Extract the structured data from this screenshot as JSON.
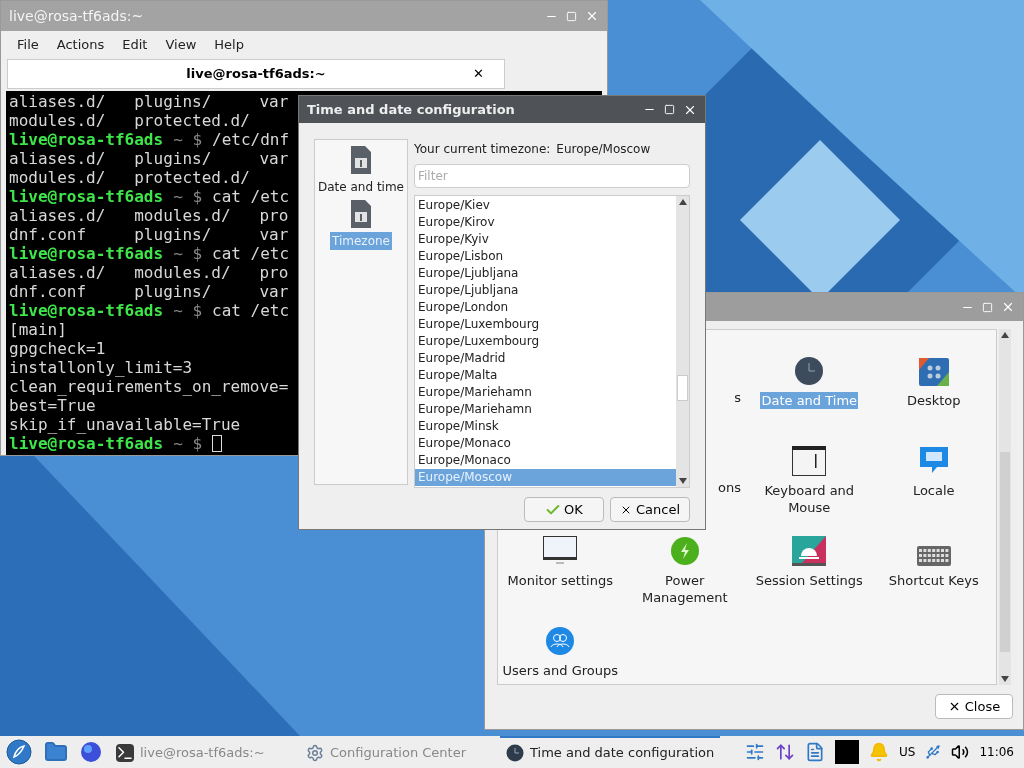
{
  "terminal": {
    "title": "live@rosa-tf6ads:~",
    "menu": [
      "File",
      "Actions",
      "Edit",
      "View",
      "Help"
    ],
    "tab": {
      "label": "live@rosa-tf6ads:~",
      "close": "✕"
    },
    "lines": [
      {
        "kind": "output",
        "text": "aliases.d/   plugins/     var"
      },
      {
        "kind": "output",
        "text": "modules.d/   protected.d/"
      },
      {
        "kind": "prompt",
        "user": "live@rosa-tf6ads",
        "symbol": "~ $",
        "command": "/etc/dnf"
      },
      {
        "kind": "output",
        "text": "aliases.d/   plugins/     var"
      },
      {
        "kind": "output",
        "text": "modules.d/   protected.d/"
      },
      {
        "kind": "prompt",
        "user": "live@rosa-tf6ads",
        "symbol": "~ $",
        "command": "cat /etc"
      },
      {
        "kind": "output",
        "text": "aliases.d/   modules.d/   pro"
      },
      {
        "kind": "output",
        "text": "dnf.conf     plugins/     var"
      },
      {
        "kind": "prompt",
        "user": "live@rosa-tf6ads",
        "symbol": "~ $",
        "command": "cat /etc"
      },
      {
        "kind": "output",
        "text": "aliases.d/   modules.d/   pro"
      },
      {
        "kind": "output",
        "text": "dnf.conf     plugins/     var"
      },
      {
        "kind": "prompt",
        "user": "live@rosa-tf6ads",
        "symbol": "~ $",
        "command": "cat /etc"
      },
      {
        "kind": "output",
        "text": "[main]"
      },
      {
        "kind": "output",
        "text": "gpgcheck=1"
      },
      {
        "kind": "output",
        "text": "installonly_limit=3"
      },
      {
        "kind": "output",
        "text": "clean_requirements_on_remove="
      },
      {
        "kind": "output",
        "text": "best=True"
      },
      {
        "kind": "output",
        "text": "skip_if_unavailable=True"
      },
      {
        "kind": "cursor",
        "user": "live@rosa-tf6ads",
        "symbol": "~ $"
      }
    ]
  },
  "dialog": {
    "title": "Time and date configuration",
    "sidebar": [
      {
        "label": "Date and time",
        "selected": false
      },
      {
        "label": "Timezone",
        "selected": true
      }
    ],
    "current_label": "Your current timezone:",
    "current_value": "Europe/Moscow",
    "filter": {
      "placeholder": "Filter"
    },
    "timezones": [
      {
        "label": "Europe/Kiev",
        "selected": false
      },
      {
        "label": "Europe/Kirov",
        "selected": false
      },
      {
        "label": "Europe/Kyiv",
        "selected": false
      },
      {
        "label": "Europe/Lisbon",
        "selected": false
      },
      {
        "label": "Europe/Ljubljana",
        "selected": false
      },
      {
        "label": "Europe/Ljubljana",
        "selected": false
      },
      {
        "label": "Europe/London",
        "selected": false
      },
      {
        "label": "Europe/Luxembourg",
        "selected": false
      },
      {
        "label": "Europe/Luxembourg",
        "selected": false
      },
      {
        "label": "Europe/Madrid",
        "selected": false
      },
      {
        "label": "Europe/Malta",
        "selected": false
      },
      {
        "label": "Europe/Mariehamn",
        "selected": false
      },
      {
        "label": "Europe/Mariehamn",
        "selected": false
      },
      {
        "label": "Europe/Minsk",
        "selected": false
      },
      {
        "label": "Europe/Monaco",
        "selected": false
      },
      {
        "label": "Europe/Monaco",
        "selected": false
      },
      {
        "label": "Europe/Moscow",
        "selected": true
      }
    ],
    "buttons": {
      "ok": "OK",
      "cancel": "Cancel"
    }
  },
  "config": {
    "items": [
      {
        "kind": "partial",
        "label": "s"
      },
      {
        "kind": "clock",
        "label": "Date and Time",
        "selected": true
      },
      {
        "kind": "desktop",
        "label": "Desktop",
        "selected": false
      },
      {
        "kind": "partial",
        "label": "ons"
      },
      {
        "kind": "keyboard-mouse",
        "label": "Keyboard and Mouse",
        "selected": false
      },
      {
        "kind": "locale",
        "label": "Locale",
        "selected": false
      },
      {
        "kind": "monitor",
        "label": "Monitor settings",
        "selected": false
      },
      {
        "kind": "power",
        "label": "Power Management",
        "selected": false
      },
      {
        "kind": "session",
        "label": "Session Settings",
        "selected": false
      },
      {
        "kind": "shortcut",
        "label": "Shortcut Keys",
        "selected": false
      },
      {
        "kind": "users",
        "label": "Users and Groups",
        "selected": false
      }
    ],
    "close": "Close"
  },
  "taskbar": {
    "tasks": [
      {
        "kind": "terminal",
        "label": "live@rosa-tf6ads:~",
        "selected": false
      },
      {
        "kind": "gear",
        "label": "Configuration Center",
        "selected": false
      },
      {
        "kind": "clock",
        "label": "Time and date configuration",
        "selected": true
      }
    ],
    "layout": "US",
    "time": "11:06"
  }
}
